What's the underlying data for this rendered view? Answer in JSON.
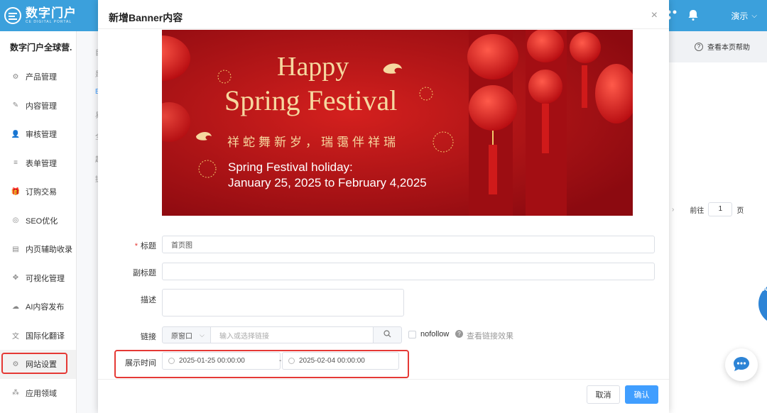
{
  "header": {
    "brand_name": "数字门户",
    "brand_sub": "CE DIGITAL PORTAL",
    "user_label": "演示"
  },
  "sidebar": {
    "title": "数字门户全球营.",
    "items": [
      {
        "label": "产品管理",
        "icon": "gear-icon"
      },
      {
        "label": "内容管理",
        "icon": "edit-icon"
      },
      {
        "label": "审核管理",
        "icon": "user-icon"
      },
      {
        "label": "表单管理",
        "icon": "list-icon"
      },
      {
        "label": "订购交易",
        "icon": "gift-icon"
      },
      {
        "label": "SEO优化",
        "icon": "target-icon"
      },
      {
        "label": "内页辅助收录",
        "icon": "document-icon"
      },
      {
        "label": "可视化管理",
        "icon": "expand-icon"
      },
      {
        "label": "AI内容发布",
        "icon": "cloud-icon"
      },
      {
        "label": "国际化翻译",
        "icon": "translate-icon"
      },
      {
        "label": "网站设置",
        "icon": "settings-icon"
      },
      {
        "label": "应用领域",
        "icon": "apps-icon"
      }
    ],
    "active_index": 10
  },
  "background_page": {
    "help_link": "查看本页帮助",
    "pager_prefix": "前往",
    "pager_value": "1",
    "pager_suffix": "页"
  },
  "dialog": {
    "title": "新增Banner内容",
    "banner": {
      "line1": "Happy",
      "line2": "Spring Festival",
      "line3": "祥蛇舞新岁，瑞霭伴祥瑞",
      "line4": "Spring Festival holiday:",
      "line5": "January 25, 2025 to February 4,2025"
    },
    "form": {
      "title_label": "标题",
      "title_value": "首页图",
      "subtitle_label": "副标题",
      "subtitle_value": "",
      "desc_label": "描述",
      "desc_value": "",
      "link_label": "链接",
      "link_target": "原窗口",
      "link_placeholder": "输入或选择链接",
      "nofollow_label": "nofollow",
      "link_effect_label": "查看链接效果",
      "time_label": "展示时间",
      "start_time": "2025-01-25 00:00:00",
      "end_time": "2025-02-04 00:00:00",
      "range_sep": "-"
    },
    "cancel_label": "取消",
    "confirm_label": "确认"
  },
  "colors": {
    "topbar": "#3ba0dc",
    "primary": "#409eff",
    "highlight": "#e53935"
  }
}
